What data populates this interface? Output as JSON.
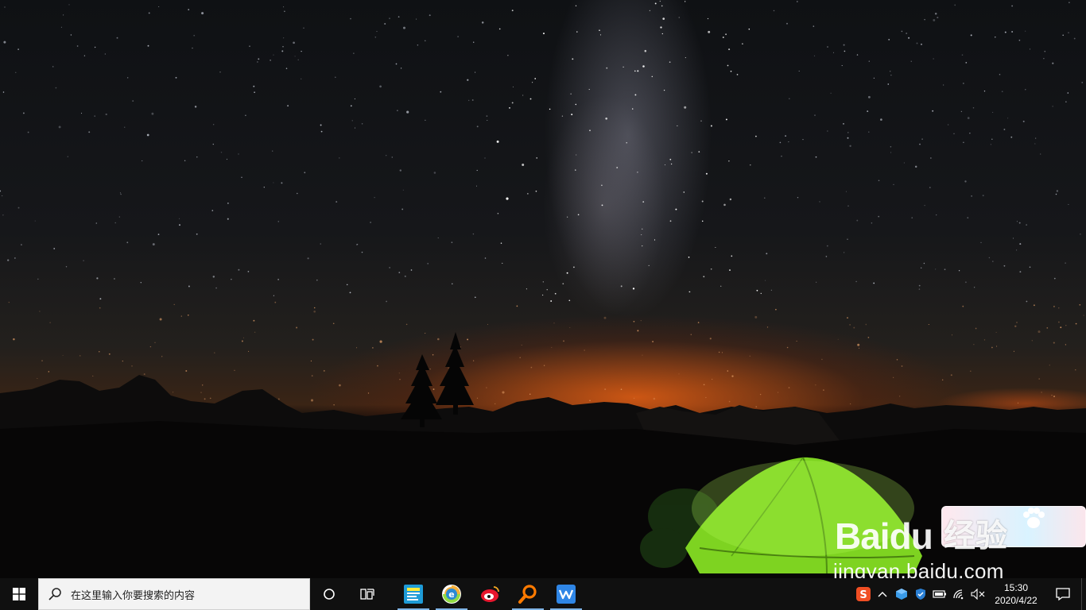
{
  "taskbar": {
    "search_placeholder": "在这里输入你要搜索的内容",
    "pinned_apps": [
      {
        "name": "news-app",
        "icon": "news-icon",
        "color": "#1e9bd7",
        "active": true
      },
      {
        "name": "edge-browser",
        "icon": "browser-e-icon",
        "color": "#2a8ad4",
        "active": true
      },
      {
        "name": "weibo",
        "icon": "weibo-icon",
        "color": "#e6162d",
        "active": false
      },
      {
        "name": "search-tool",
        "icon": "magnifier-icon",
        "color": "#ff7a00",
        "active": true
      },
      {
        "name": "wps-office",
        "icon": "wps-w-icon",
        "color": "#2f86e6",
        "active": true
      }
    ],
    "tray": {
      "clock_time": "15:30",
      "clock_date": "2020/4/22"
    }
  },
  "watermark": {
    "brand_left": "Bai",
    "brand_right": "du",
    "product": "经验",
    "url": "jingyan.baidu.com"
  },
  "colors": {
    "taskbar_bg": "#101010",
    "search_bg": "#f3f3f3",
    "tent_green": "#7ed321",
    "active_underline": "#7fb4e6"
  }
}
